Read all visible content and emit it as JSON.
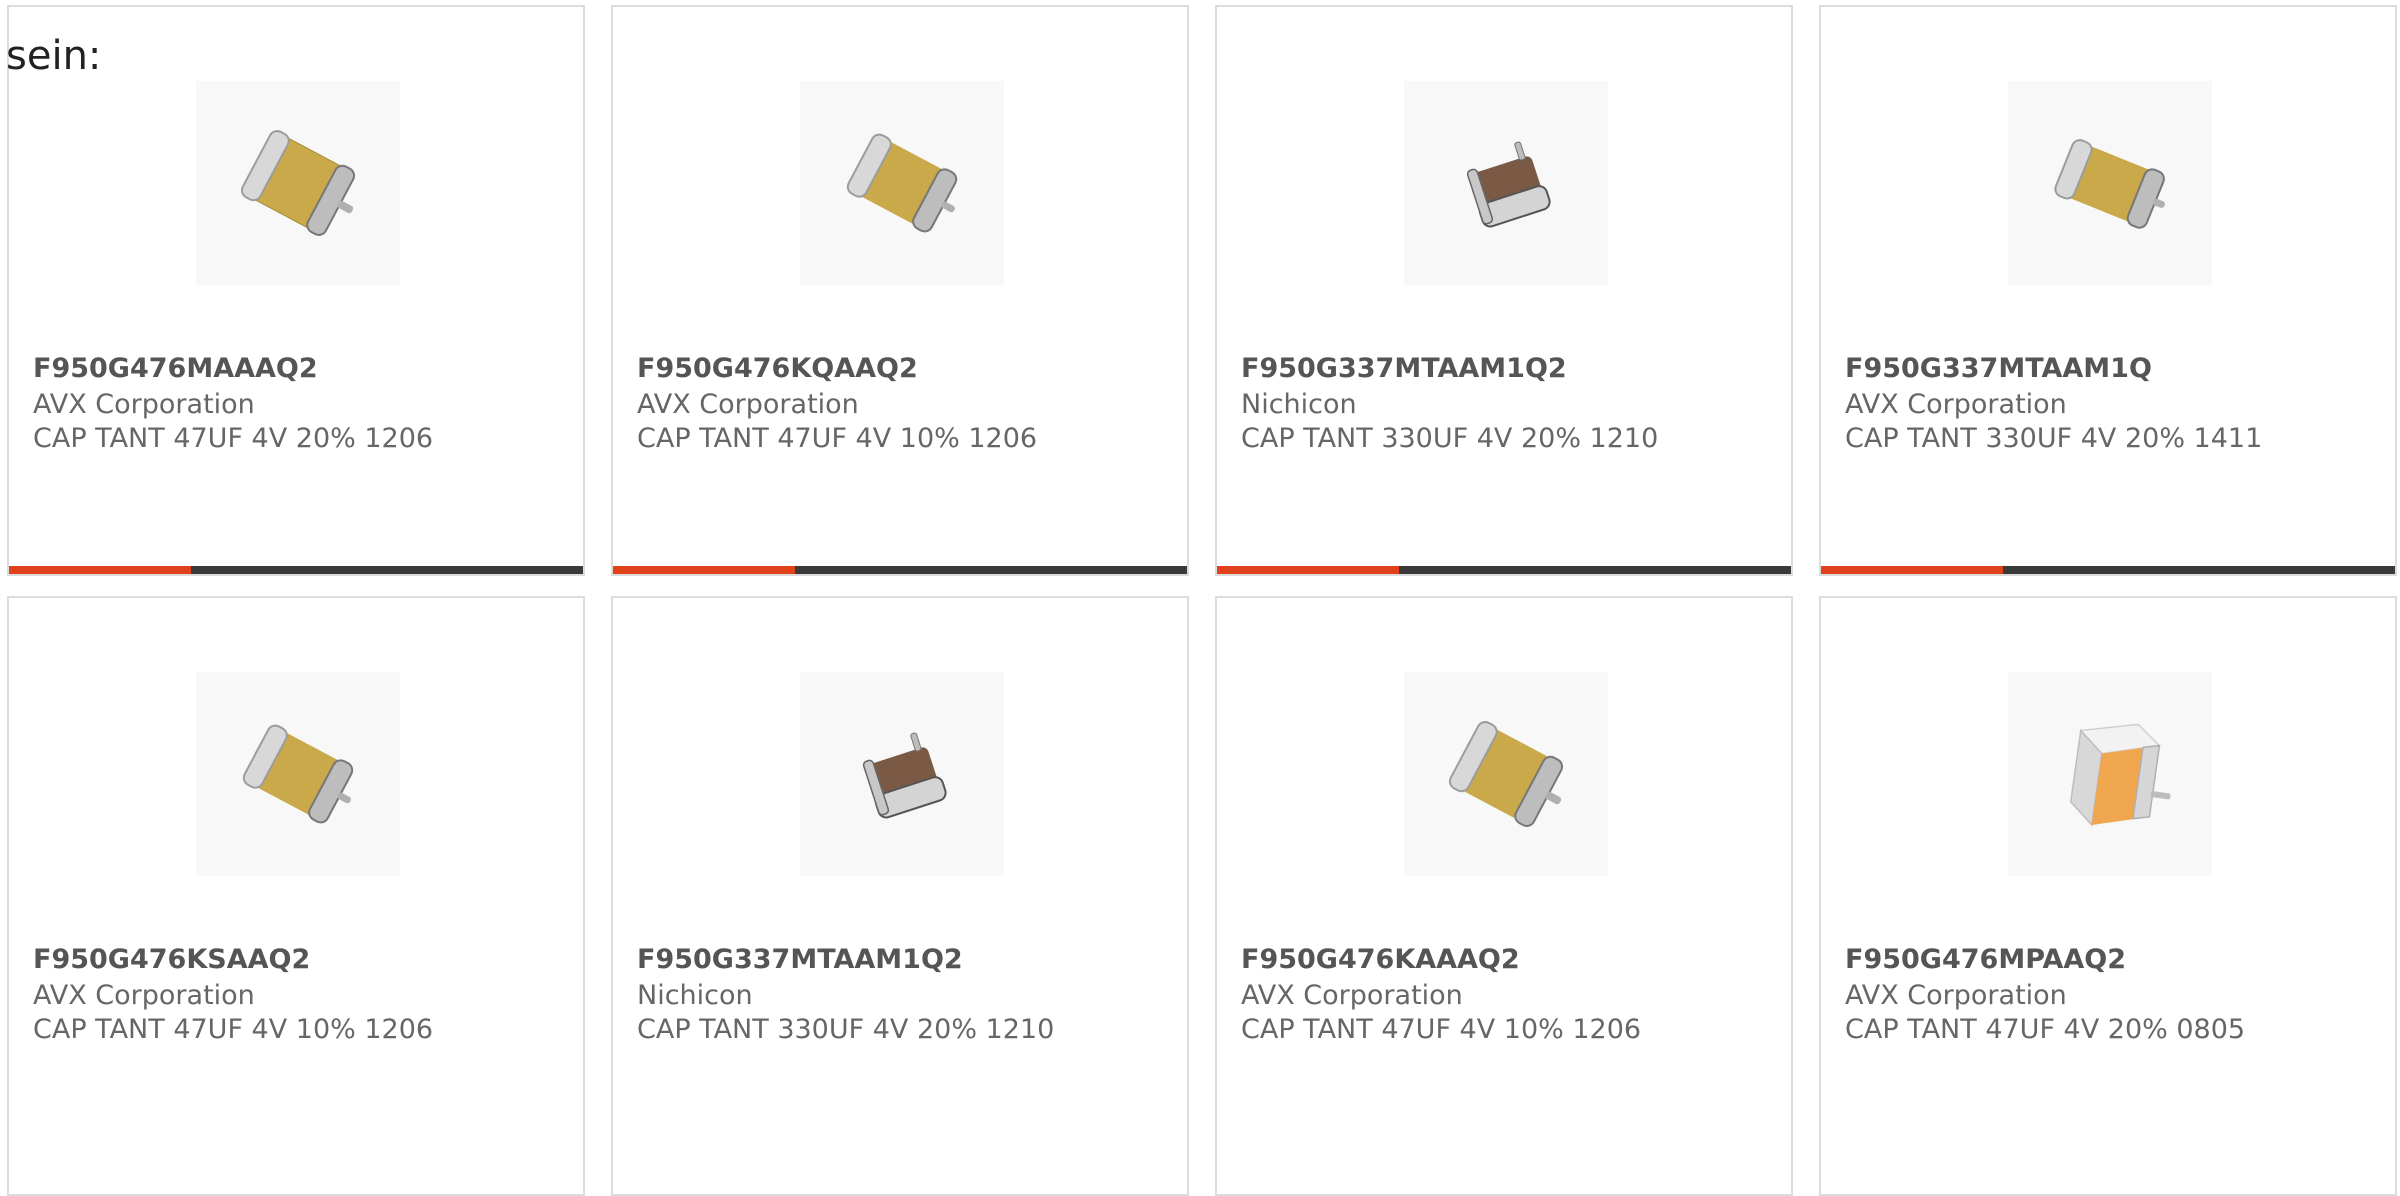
{
  "intro_text": "sein:",
  "colors": {
    "accent": "#e0401a",
    "bar": "#3a3a3a",
    "border": "#dcdcdc",
    "part_text": "#555555",
    "body_text": "#666666"
  },
  "products": [
    {
      "part": "F950G476MAAAQ2",
      "manufacturer": "AVX Corporation",
      "description": "CAP TANT 47UF 4V 20% 1206",
      "image_icon": "tantalum-capacitor-yellow-icon"
    },
    {
      "part": "F950G476KQAAQ2",
      "manufacturer": "AVX Corporation",
      "description": "CAP TANT 47UF 4V 10% 1206",
      "image_icon": "tantalum-capacitor-yellow-icon"
    },
    {
      "part": "F950G337MTAAM1Q2",
      "manufacturer": "Nichicon",
      "description": "CAP TANT 330UF 4V 20% 1210",
      "image_icon": "tantalum-capacitor-brown-icon"
    },
    {
      "part": "F950G337MTAAM1Q",
      "manufacturer": "AVX Corporation",
      "description": "CAP TANT 330UF 4V 20% 1411",
      "image_icon": "tantalum-capacitor-yellow-icon"
    },
    {
      "part": "F950G476KSAAQ2",
      "manufacturer": "AVX Corporation",
      "description": "CAP TANT 47UF 4V 10% 1206",
      "image_icon": "tantalum-capacitor-yellow-icon"
    },
    {
      "part": "F950G337MTAAM1Q2",
      "manufacturer": "Nichicon",
      "description": "CAP TANT 330UF 4V 20% 1210",
      "image_icon": "tantalum-capacitor-brown-icon"
    },
    {
      "part": "F950G476KAAAQ2",
      "manufacturer": "AVX Corporation",
      "description": "CAP TANT 47UF 4V 10% 1206",
      "image_icon": "tantalum-capacitor-yellow-icon"
    },
    {
      "part": "F950G476MPAAQ2",
      "manufacturer": "AVX Corporation",
      "description": "CAP TANT 47UF 4V 20% 0805",
      "image_icon": "tantalum-capacitor-orange-icon"
    }
  ]
}
